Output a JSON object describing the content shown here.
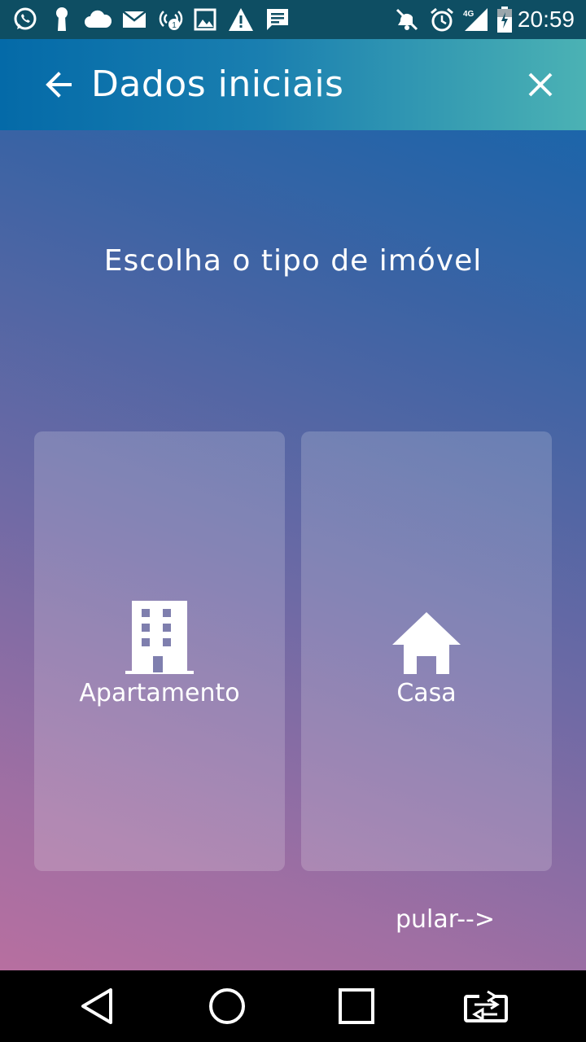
{
  "status_bar": {
    "time": "20:59",
    "network_label": "4G",
    "icons": [
      "whatsapp-icon",
      "keyhole-icon",
      "cloud-icon",
      "mail-icon",
      "hotspot-icon",
      "image-icon",
      "warning-icon",
      "message-icon",
      "mute-icon",
      "alarm-icon",
      "signal-icon",
      "battery-icon"
    ]
  },
  "app_bar": {
    "title": "Dados iniciais"
  },
  "main": {
    "prompt": "Escolha o tipo de imóvel",
    "options": [
      {
        "label": "Apartamento",
        "icon": "building-icon"
      },
      {
        "label": "Casa",
        "icon": "house-icon"
      }
    ],
    "skip_label": "pular-->"
  },
  "nav_bar": {
    "buttons": [
      "back-triangle-icon",
      "home-circle-icon",
      "recents-square-icon",
      "switch-app-icon"
    ]
  },
  "colors": {
    "status_bar": "#0e4e63",
    "app_bar_start": "#046aa8",
    "app_bar_end": "#4bb2b4",
    "background_top": "#0a66ad",
    "background_bottom": "#b76fa0"
  }
}
